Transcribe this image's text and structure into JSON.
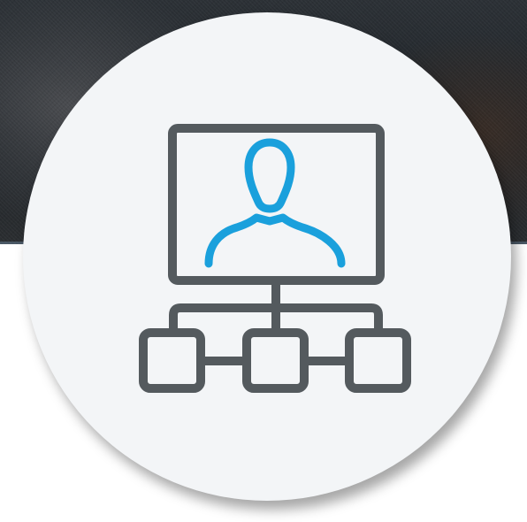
{
  "background": {
    "kind": "dark photo strip"
  },
  "badge": {
    "background_color": "#f3f5f7",
    "icon": {
      "name": "org-chart-user-icon",
      "stroke_color": "#545a5e",
      "accent_color": "#1aa0dc"
    }
  }
}
